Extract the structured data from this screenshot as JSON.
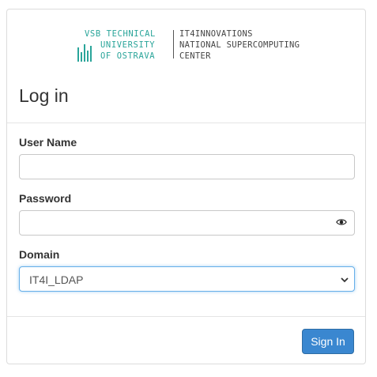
{
  "logo": {
    "vsb_lines": [
      "VSB TECHNICAL",
      "UNIVERSITY",
      "OF OSTRAVA"
    ],
    "it4i_lines": [
      "IT4INNOVATIONS",
      "NATIONAL SUPERCOMPUTING",
      "CENTER"
    ],
    "accent_color": "#2aa59a"
  },
  "page": {
    "title": "Log in"
  },
  "form": {
    "username": {
      "label": "User Name",
      "value": "",
      "placeholder": ""
    },
    "password": {
      "label": "Password",
      "value": "",
      "placeholder": "",
      "toggle_icon": "eye-icon"
    },
    "domain": {
      "label": "Domain",
      "selected": "IT4I_LDAP",
      "focus_color": "#66afe9"
    }
  },
  "actions": {
    "sign_in_label": "Sign In",
    "button_color": "#3a87d0"
  }
}
